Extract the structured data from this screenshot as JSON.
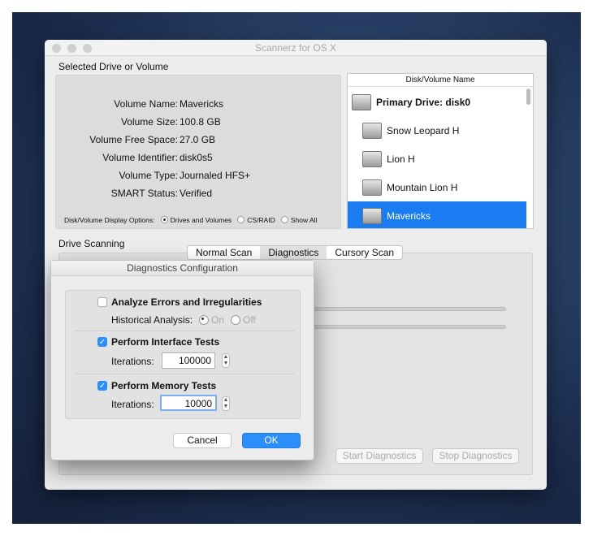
{
  "window": {
    "title": "Scannerz for OS X"
  },
  "selected": {
    "heading": "Selected Drive or Volume",
    "fields": [
      {
        "label": "Volume Name:",
        "value": "Mavericks"
      },
      {
        "label": "Volume Size:",
        "value": "100.8 GB"
      },
      {
        "label": "Volume Free Space:",
        "value": "27.0 GB"
      },
      {
        "label": "Volume Identifier:",
        "value": "disk0s5"
      },
      {
        "label": "Volume Type:",
        "value": "Journaled HFS+"
      },
      {
        "label": "SMART Status:",
        "value": "Verified"
      }
    ],
    "display_options_label": "Disk/Volume Display Options:",
    "options": [
      {
        "label": "Drives and Volumes",
        "selected": true
      },
      {
        "label": "CS/RAID",
        "selected": false
      },
      {
        "label": "Show All",
        "selected": false
      }
    ]
  },
  "list": {
    "header": "Disk/Volume Name",
    "items": [
      {
        "label": "Primary Drive: disk0",
        "bold": true
      },
      {
        "label": "Snow Leopard H"
      },
      {
        "label": "Lion H"
      },
      {
        "label": "Mountain Lion H"
      },
      {
        "label": "Mavericks",
        "selected": true
      }
    ],
    "selected_color": "#1a7cf0"
  },
  "scanning": {
    "heading": "Drive Scanning",
    "tabs": [
      {
        "label": "Normal Scan"
      },
      {
        "label": "Diagnostics",
        "selected": true
      },
      {
        "label": "Cursory Scan"
      }
    ],
    "start": "Start Diagnostics",
    "stop": "Stop Diagnostics"
  },
  "dialog": {
    "title": "Diagnostics Configuration",
    "analyze": {
      "label": "Analyze Errors and Irregularities",
      "checked": false
    },
    "historical": {
      "label": "Historical Analysis:",
      "on": "On",
      "off": "Off",
      "selected": "On"
    },
    "interface": {
      "label": "Perform Interface Tests",
      "checked": true,
      "iter_label": "Iterations:",
      "iter_value": "100000"
    },
    "memory": {
      "label": "Perform Memory Tests",
      "checked": true,
      "iter_label": "Iterations:",
      "iter_value": "10000"
    },
    "cancel": "Cancel",
    "ok": "OK",
    "accent": "#2c8ef8"
  }
}
